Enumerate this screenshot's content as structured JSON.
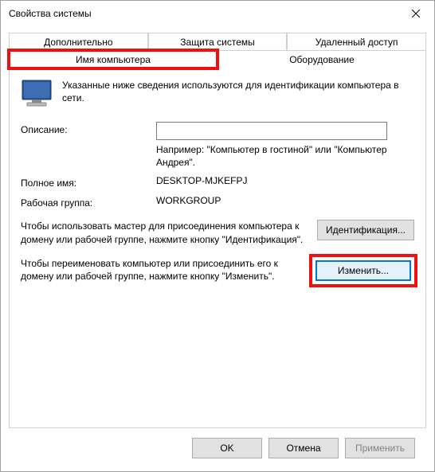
{
  "window": {
    "title": "Свойства системы"
  },
  "tabs": {
    "row1": [
      {
        "label": "Дополнительно"
      },
      {
        "label": "Защита системы"
      },
      {
        "label": "Удаленный доступ"
      }
    ],
    "row2": [
      {
        "label": "Имя компьютера"
      },
      {
        "label": "Оборудование"
      }
    ]
  },
  "intro": "Указанные ниже сведения используются для идентификации компьютера в сети.",
  "description": {
    "label": "Описание:",
    "value": "",
    "hint": "Например: \"Компьютер в гостиной\" или \"Компьютер Андрея\"."
  },
  "full_name": {
    "label": "Полное имя:",
    "value": "DESKTOP-MJKEFPJ"
  },
  "workgroup": {
    "label": "Рабочая группа:",
    "value": "WORKGROUP"
  },
  "identify": {
    "text": "Чтобы использовать мастер для присоединения компьютера к домену или рабочей группе, нажмите кнопку \"Идентификация\".",
    "button": "Идентификация..."
  },
  "change": {
    "text": "Чтобы переименовать компьютер или присоединить его к домену или рабочей группе, нажмите кнопку \"Изменить\".",
    "button": "Изменить..."
  },
  "buttons": {
    "ok": "OK",
    "cancel": "Отмена",
    "apply": "Применить"
  }
}
